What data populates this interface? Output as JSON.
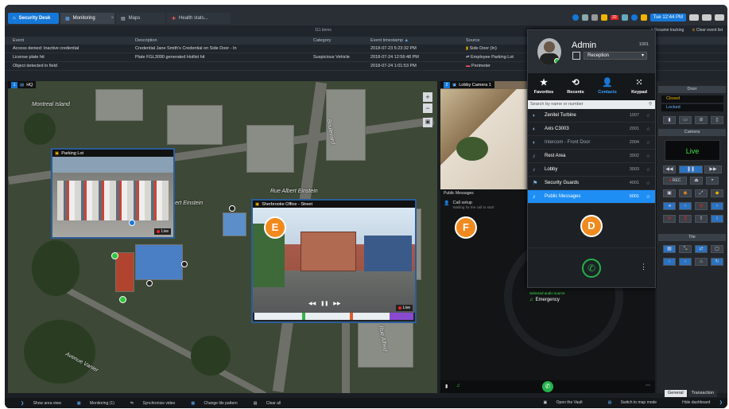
{
  "tabs": [
    {
      "label": "Security Desk"
    },
    {
      "label": "Monitoring",
      "close": "×"
    },
    {
      "label": "Maps"
    },
    {
      "label": "Health stats..."
    }
  ],
  "tray": {
    "clock": "Tue 12:44 PM",
    "badge": "20"
  },
  "events": {
    "count": "111 items",
    "resume": "Resume tracking",
    "clear": "Clear event list",
    "columns": [
      "Event",
      "Description",
      "Category",
      "Event timestamp",
      "Source"
    ],
    "rows": [
      [
        "Access denied: Inactive credential",
        "Credential Jane Smith's Credential on Side Door - In",
        "",
        "2018-07-23 5:23:32 PM",
        "Side Door (In)"
      ],
      [
        "License plate hit",
        "Plate FGL3090 generated Hotlist hit",
        "Suspicious Vehicle",
        "2018-07-24 12:56:48 PM",
        "Employee Parking Lot"
      ],
      [
        "Object detected in field",
        "",
        "",
        "2018-07-24 1:01:53 PM",
        "Perimeter"
      ]
    ]
  },
  "map": {
    "tile_number": "1",
    "tile_title": "HQ",
    "labels": {
      "montreal_island": "Montreal Island",
      "albert_einstein": "Rue Albert Einstein",
      "albert_einstein_2": "Albert Einstein",
      "boulevard": "Boulevard",
      "avenue": "Avenue Vanier",
      "rue_alfred": "Rue Alfred"
    },
    "parking_lot": {
      "title": "Parking Lot",
      "live": "Live"
    },
    "sherbrooke": {
      "title": "Sherbrooke Office - Street",
      "live": "Live"
    },
    "badge_e": "E"
  },
  "lobby": {
    "number": "2",
    "title": "Lobby Camera 1"
  },
  "public_messages": {
    "title": "Public Messages",
    "call_setup": "Call setup",
    "waiting": "Waiting for the call to start",
    "selected_audio": "Selected audio source",
    "emergency": "Emergency",
    "badge_f": "F"
  },
  "contacts": {
    "name": "Admin",
    "extension": "1001",
    "location": "Reception",
    "nav": [
      {
        "label": "Favorites",
        "glyph": "★"
      },
      {
        "label": "Recents",
        "glyph": "⟲"
      },
      {
        "label": "Contacts",
        "glyph": "👤"
      },
      {
        "label": "Keypad",
        "glyph": "⁙"
      }
    ],
    "search_placeholder": "Search by name or number",
    "list": [
      {
        "name": "Zenitel Turbine",
        "ext": "1007"
      },
      {
        "name": "Axis C3003",
        "ext": "2001"
      },
      {
        "name": "Intercom - Front Door",
        "ext": "2004"
      },
      {
        "name": "Rest Area",
        "ext": "3002"
      },
      {
        "name": "Lobby",
        "ext": "3003"
      },
      {
        "name": "Security Guards",
        "ext": "4001"
      },
      {
        "name": "Public Messages",
        "ext": "6001"
      }
    ],
    "badge_d": "D"
  },
  "side_panel": {
    "door_title": "Door",
    "door_closed": "Closed",
    "door_locked": "Locked",
    "camera_title": "Camera",
    "camera_live": "Live",
    "rec": "REC",
    "tile_title": "Tile"
  },
  "right_tabs": [
    "General",
    "Transaction"
  ],
  "status_bar": {
    "left": [
      "Show area view",
      "Monitoring (1)",
      "Synchronize video",
      "Change tile pattern",
      "Clear all"
    ],
    "right": [
      "Open the Vault",
      "Switch to map mode",
      "Hide dashboard"
    ]
  },
  "colors": {
    "accent": "#1578d8",
    "badge": "#f08a1e",
    "live": "#e22222",
    "call": "#24b24b"
  }
}
